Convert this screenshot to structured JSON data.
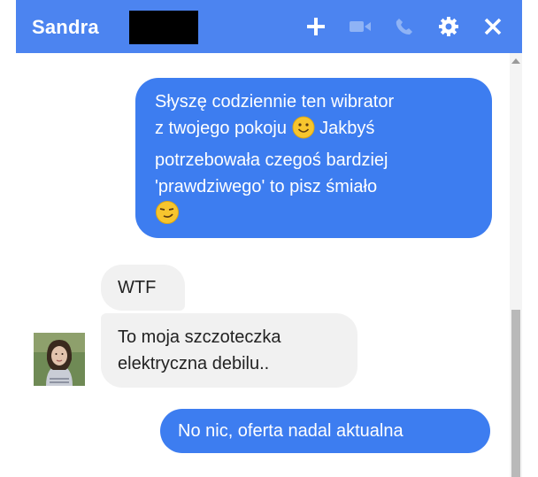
{
  "header": {
    "contact_name": "Sandra",
    "icons": [
      "plus-icon",
      "video-camera-icon",
      "phone-icon",
      "gear-icon",
      "close-icon"
    ]
  },
  "messages": [
    {
      "direction": "outgoing",
      "line1": "Słyszę codziennie ten wibrator",
      "line2a": "z twojego pokoju",
      "line2b": "Jakbyś",
      "line3": "potrzebowała czegoś bardziej",
      "line4": "'prawdziwego' to pisz śmiało",
      "emojis": [
        "smiling-face-emoji",
        "smirking-face-emoji"
      ]
    },
    {
      "direction": "incoming",
      "text": "WTF"
    },
    {
      "direction": "incoming",
      "line1": "To moja szczoteczka",
      "line2": "elektryczna debilu.."
    },
    {
      "direction": "outgoing",
      "text": "No nic, oferta nadal aktualna"
    }
  ],
  "colors": {
    "header_bg": "#4c84f0",
    "outgoing_bubble": "#3d7df0",
    "incoming_bubble": "#f1f1f1",
    "disabled_icon": "#8fb3f5"
  }
}
